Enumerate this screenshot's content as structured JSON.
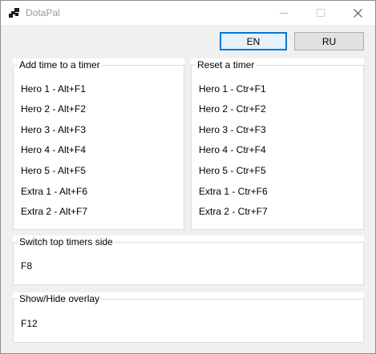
{
  "window": {
    "title": "DotaPal",
    "icons": [
      "app-icon",
      "minimize-icon",
      "maximize-icon",
      "close-icon"
    ]
  },
  "language": {
    "en_label": "EN",
    "ru_label": "RU",
    "selected": "EN"
  },
  "add_time": {
    "title": "Add time to a timer",
    "items": [
      "Hero 1 - Alt+F1",
      "Hero 2 - Alt+F2",
      "Hero 3 - Alt+F3",
      "Hero 4 - Alt+F4",
      "Hero 5 - Alt+F5",
      "Extra 1 - Alt+F6",
      "Extra 2 - Alt+F7"
    ]
  },
  "reset": {
    "title": "Reset a timer",
    "items": [
      "Hero 1 - Ctr+F1",
      "Hero 2 - Ctr+F2",
      "Hero 3 - Ctr+F3",
      "Hero 4 - Ctr+F4",
      "Hero 5 - Ctr+F5",
      "Extra 1 - Ctr+F6",
      "Extra 2 - Ctr+F7"
    ]
  },
  "switch_side": {
    "title": "Switch top timers side",
    "key": "F8"
  },
  "overlay": {
    "title": "Show/Hide overlay",
    "key": "F12"
  },
  "colors": {
    "accent": "#0078d7",
    "selected_button_bg": "#e5f1fb",
    "button_bg": "#e1e1e1",
    "window_bg": "#f0f0f0",
    "panel_bg": "#ffffff",
    "title_text": "#999999"
  }
}
